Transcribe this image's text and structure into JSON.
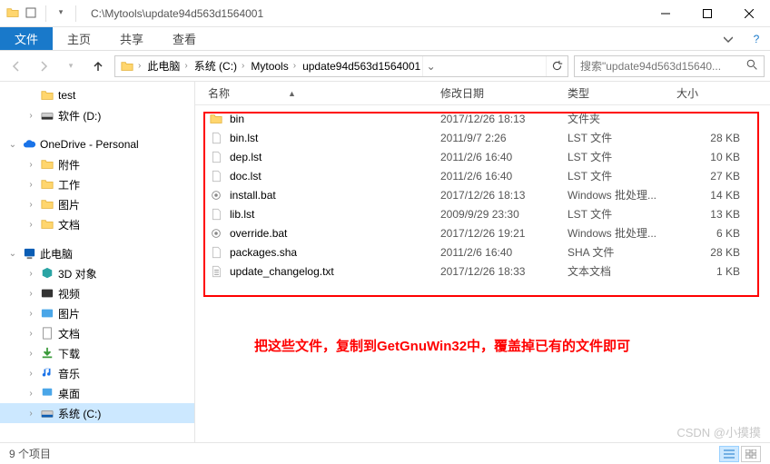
{
  "title_path": "C:\\Mytools\\update94d563d1564001",
  "tabs": {
    "file": "文件",
    "home": "主页",
    "share": "共享",
    "view": "查看"
  },
  "breadcrumbs": [
    "此电脑",
    "系统 (C:)",
    "Mytools",
    "update94d563d1564001"
  ],
  "search_placeholder": "搜索\"update94d563d15640...",
  "columns": {
    "name": "名称",
    "date": "修改日期",
    "type": "类型",
    "size": "大小"
  },
  "tree": {
    "test": "test",
    "software_d": "软件 (D:)",
    "onedrive": "OneDrive - Personal",
    "attachments": "附件",
    "work": "工作",
    "pictures": "图片",
    "documents": "文档",
    "this_pc": "此电脑",
    "objects3d": "3D 对象",
    "videos": "视频",
    "pictures2": "图片",
    "documents2": "文档",
    "downloads": "下载",
    "music": "音乐",
    "desktop": "桌面",
    "system_c": "系统 (C:)"
  },
  "files": [
    {
      "name": "bin",
      "date": "2017/12/26 18:13",
      "type": "文件夹",
      "size": "",
      "icon": "folder"
    },
    {
      "name": "bin.lst",
      "date": "2011/9/7 2:26",
      "type": "LST 文件",
      "size": "28 KB",
      "icon": "file"
    },
    {
      "name": "dep.lst",
      "date": "2011/2/6 16:40",
      "type": "LST 文件",
      "size": "10 KB",
      "icon": "file"
    },
    {
      "name": "doc.lst",
      "date": "2011/2/6 16:40",
      "type": "LST 文件",
      "size": "27 KB",
      "icon": "file"
    },
    {
      "name": "install.bat",
      "date": "2017/12/26 18:13",
      "type": "Windows 批处理...",
      "size": "14 KB",
      "icon": "gear"
    },
    {
      "name": "lib.lst",
      "date": "2009/9/29 23:30",
      "type": "LST 文件",
      "size": "13 KB",
      "icon": "file"
    },
    {
      "name": "override.bat",
      "date": "2017/12/26 19:21",
      "type": "Windows 批处理...",
      "size": "6 KB",
      "icon": "gear"
    },
    {
      "name": "packages.sha",
      "date": "2011/2/6 16:40",
      "type": "SHA 文件",
      "size": "28 KB",
      "icon": "file"
    },
    {
      "name": "update_changelog.txt",
      "date": "2017/12/26 18:33",
      "type": "文本文档",
      "size": "1 KB",
      "icon": "text"
    }
  ],
  "annotation": "把这些文件，复制到GetGnuWin32中，覆盖掉已有的文件即可",
  "status": "9 个项目",
  "watermark": "CSDN @小摸摸"
}
